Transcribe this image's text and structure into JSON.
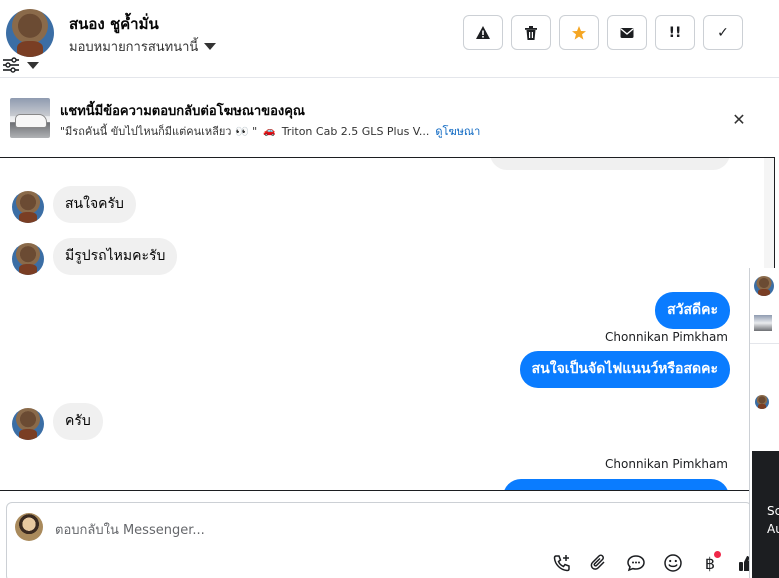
{
  "header": {
    "contact_name": "สนอง ชูค้ำมั่น",
    "assign_label": "มอบหมายการสนทนานี้",
    "actions": [
      {
        "name": "report-icon",
        "glyph": "!"
      },
      {
        "name": "trash-icon",
        "glyph": ""
      },
      {
        "name": "star-icon",
        "glyph": "★"
      },
      {
        "name": "mail-icon",
        "glyph": ""
      },
      {
        "name": "follow-up-icon",
        "glyph": "!!"
      },
      {
        "name": "check-icon",
        "glyph": "✓"
      }
    ]
  },
  "banner": {
    "title": "แชทนี้มีข้อความตอบกลับต่อโฆษณาของคุณ",
    "quote": "\"มีรถคันนี้ ขับไปไหนก็มีแต่คนเหลียว 👀 \"",
    "ad_name": "Triton Cab 2.5 GLS Plus V...",
    "view_ad_link": "ดูโฆษณา",
    "close_glyph": "✕"
  },
  "messages": [
    {
      "direction": "in",
      "text": "สนใจครับ"
    },
    {
      "direction": "in",
      "text": "มีรูปรถไหมคะรับ"
    },
    {
      "direction": "out",
      "text": "สวัสดีคะ"
    },
    {
      "direction": "out",
      "sender": "Chonnikan Pimkham",
      "text": "สนใจเป็นจัดไฟแนนว์หรือสดคะ"
    },
    {
      "direction": "in",
      "text": "ครับ"
    },
    {
      "direction": "out",
      "sender": "Chonnikan Pimkham",
      "text": ""
    }
  ],
  "composer": {
    "placeholder": "ตอบกลับใน Messenger...",
    "tools": [
      "call-add-icon",
      "attachment-icon",
      "saved-reply-icon",
      "emoji-icon",
      "payment-icon",
      "like-icon"
    ],
    "payment_glyph": "฿"
  },
  "side_panel": {
    "text1": "Sc",
    "text2": "Au"
  },
  "colors": {
    "accent": "#0a7cff",
    "incoming_bubble": "#f0f0f0",
    "star": "#f5a623",
    "badge": "#f02849"
  }
}
